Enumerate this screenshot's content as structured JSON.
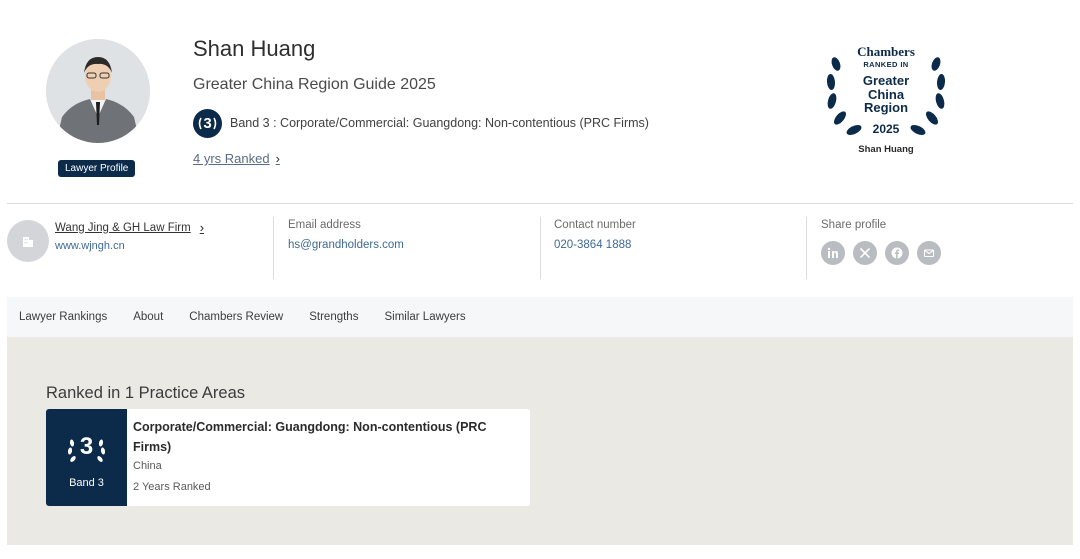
{
  "profile": {
    "name": "Shan Huang",
    "guide": "Greater China Region Guide 2025",
    "badge_label": "Lawyer Profile",
    "band_number": "3",
    "band_text": "Band 3 : Corporate/Commercial: Guangdong: Non-contentious (PRC Firms)",
    "years_link": "4 yrs Ranked"
  },
  "chambers_badge": {
    "brand": "Chambers",
    "ranked_in": "RANKED IN",
    "region_line1": "Greater",
    "region_line2": "China",
    "region_line3": "Region",
    "year": "2025",
    "name": "Shan Huang"
  },
  "info": {
    "firm_name": "Wang Jing & GH Law Firm",
    "firm_url": "www.wjngh.cn",
    "email_label": "Email address",
    "email_value": "hs@grandholders.com",
    "contact_label": "Contact number",
    "contact_value": "020-3864 1888",
    "share_label": "Share profile",
    "share_icons": [
      "linkedin-icon",
      "x-icon",
      "facebook-icon",
      "email-icon"
    ]
  },
  "tabs": [
    {
      "label": "Lawyer Rankings"
    },
    {
      "label": "About"
    },
    {
      "label": "Chambers Review"
    },
    {
      "label": "Strengths"
    },
    {
      "label": "Similar Lawyers"
    }
  ],
  "rankings": {
    "section_title": "Ranked in 1 Practice Areas",
    "card": {
      "band_number": "3",
      "band_label": "Band 3",
      "title": "Corporate/Commercial: Guangdong: Non-contentious (PRC Firms)",
      "location": "China",
      "years": "2 Years Ranked"
    }
  },
  "colors": {
    "navy": "#0c2b4b",
    "link": "#3e6a95",
    "main_bg": "#ebe9e4",
    "tabs_bg": "#f6f7f8"
  }
}
